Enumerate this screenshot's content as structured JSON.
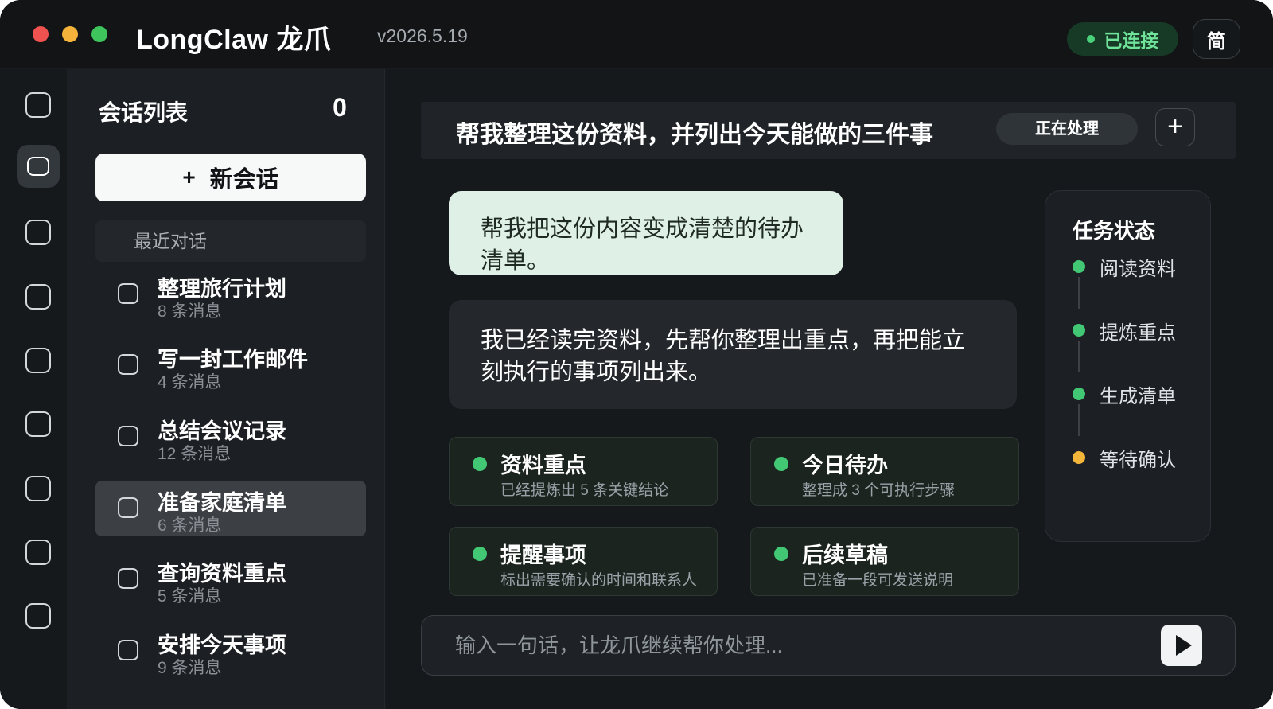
{
  "window": {
    "app_title": "LongClaw 龙爪",
    "version": "v2026.5.19",
    "connection_status": "已连接",
    "language_button": "简"
  },
  "sidebar": {
    "title": "会话列表",
    "count": "0",
    "new_chat_icon": "+",
    "new_chat_label": "新会话",
    "recent_label": "最近对话",
    "conversations": [
      {
        "title": "整理旅行计划",
        "subtitle": "8 条消息"
      },
      {
        "title": "写一封工作邮件",
        "subtitle": "4 条消息"
      },
      {
        "title": "总结会议记录",
        "subtitle": "12 条消息"
      },
      {
        "title": "准备家庭清单",
        "subtitle": "6 条消息"
      },
      {
        "title": "查询资料重点",
        "subtitle": "5 条消息"
      },
      {
        "title": "安排今天事项",
        "subtitle": "9 条消息"
      }
    ],
    "selected_conversation": "准备家庭清单"
  },
  "header": {
    "title": "帮我整理这份资料，并列出今天能做的三件事",
    "status": "正在处理",
    "add_icon": "+"
  },
  "messages": {
    "user": "帮我把这份内容变成清楚的待办清单。",
    "assistant": "我已经读完资料，先帮你整理出重点，再把能立刻执行的事项列出来。"
  },
  "result_cards": [
    {
      "title": "资料重点",
      "subtitle": "已经提炼出 5 条关键结论"
    },
    {
      "title": "今日待办",
      "subtitle": "整理成 3 个可执行步骤"
    },
    {
      "title": "提醒事项",
      "subtitle": "标出需要确认的时间和联系人"
    },
    {
      "title": "后续草稿",
      "subtitle": "已准备一段可发送说明"
    }
  ],
  "task_status": {
    "title": "任务状态",
    "steps": [
      {
        "label": "阅读资料",
        "state": "done"
      },
      {
        "label": "提炼重点",
        "state": "done"
      },
      {
        "label": "生成清单",
        "state": "done"
      },
      {
        "label": "等待确认",
        "state": "pending"
      }
    ]
  },
  "composer": {
    "placeholder": "输入一句话，让龙爪继续帮你处理...",
    "value": ""
  },
  "icons": {
    "send": "play-icon",
    "rail": [
      "square-icon",
      "chat-icon",
      "square-icon",
      "square-icon",
      "square-icon",
      "square-icon",
      "square-icon",
      "square-icon",
      "square-icon"
    ]
  },
  "colors": {
    "window_bg": "#181b1f",
    "accent_green": "#42c874",
    "pending_yellow": "#f4b63a",
    "user_bubble": "#dff0e6",
    "connected_text": "#6fe39a"
  }
}
